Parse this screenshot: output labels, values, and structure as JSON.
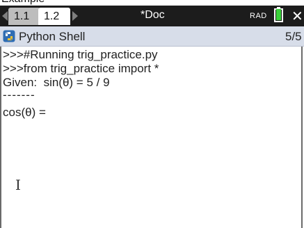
{
  "top_crop": {
    "text": "Example"
  },
  "tabs": [
    {
      "label": "1.1",
      "active": false
    },
    {
      "label": "1.2",
      "active": true
    }
  ],
  "document": {
    "title": "*Doc"
  },
  "status": {
    "angle_mode": "RAD",
    "battery_level": 1.0,
    "battery_color": "#3ad23a"
  },
  "app": {
    "title": "Python Shell",
    "page_indicator": "5/5",
    "icon": "python-icon"
  },
  "console": {
    "lines": [
      ">>>#Running trig_practice.py",
      ">>>from trig_practice import *",
      "Given:  sin(θ) = 5 / 9",
      "-------",
      "cos(θ) = "
    ]
  },
  "colors": {
    "tabbar_bg": "#1c1c1c",
    "header_bg": "#d7dde9",
    "console_bg": "#ffffff"
  }
}
